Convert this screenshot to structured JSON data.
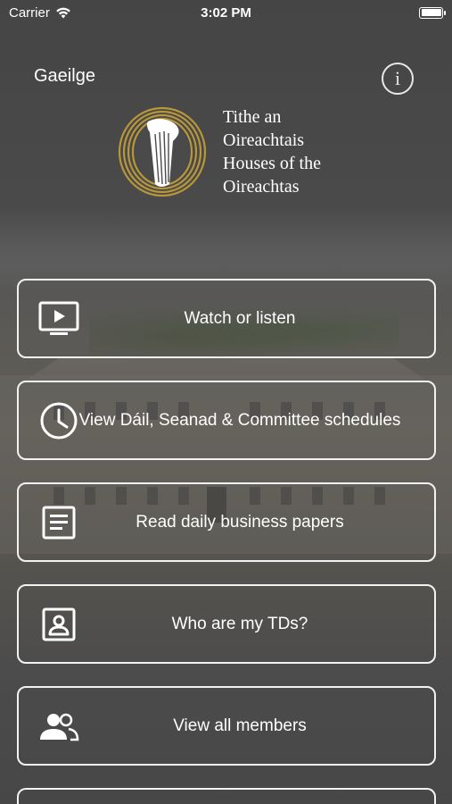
{
  "status_bar": {
    "carrier": "Carrier",
    "time": "3:02 PM"
  },
  "header": {
    "language_toggle": "Gaeilge",
    "info_icon": "i"
  },
  "logo": {
    "lines": [
      "Tithe an",
      "Oireachtais",
      "Houses of the",
      "Oireachtas"
    ],
    "ring_color": "#b8963a",
    "harp_color": "#ffffff"
  },
  "menu": {
    "items": [
      {
        "label": "Watch or listen",
        "icon": "tv-play-icon"
      },
      {
        "label": "View Dáil, Seanad & Committee schedules",
        "icon": "clock-icon"
      },
      {
        "label": "Read daily business papers",
        "icon": "document-icon"
      },
      {
        "label": "Who are my TDs?",
        "icon": "contact-card-icon"
      },
      {
        "label": "View all members",
        "icon": "group-icon"
      }
    ]
  },
  "colors": {
    "button_border": "#f2f2f2",
    "text": "#ffffff",
    "logo_gold": "#b8963a"
  }
}
